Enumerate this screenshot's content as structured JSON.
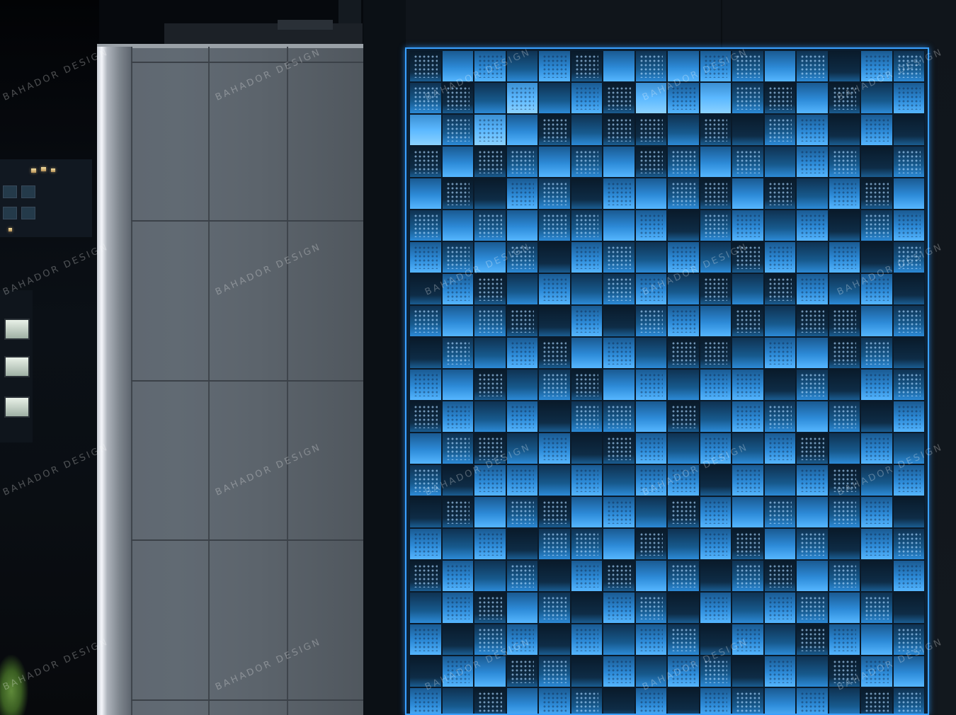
{
  "photo": {
    "watermark_text": "BAHADOR DESIGN",
    "colors": {
      "facade_glow": "#3aa0ff",
      "grey_panel": "#5e666f",
      "night_sky": "#06090d"
    },
    "facade_pattern": [
      [
        0,
        2,
        2,
        1,
        2,
        0,
        2,
        1,
        2,
        2,
        1,
        2,
        1,
        0,
        2,
        1
      ],
      [
        1,
        0,
        1,
        3,
        1,
        2,
        0,
        3,
        2,
        3,
        1,
        0,
        2,
        0,
        1,
        2
      ],
      [
        3,
        1,
        3,
        2,
        0,
        1,
        0,
        0,
        1,
        0,
        0,
        1,
        2,
        0,
        2,
        0
      ],
      [
        0,
        2,
        0,
        1,
        2,
        1,
        2,
        0,
        1,
        2,
        1,
        1,
        2,
        1,
        0,
        1
      ],
      [
        2,
        0,
        0,
        2,
        1,
        0,
        2,
        2,
        1,
        0,
        2,
        0,
        1,
        2,
        0,
        2
      ],
      [
        1,
        2,
        1,
        2,
        1,
        1,
        2,
        2,
        0,
        1,
        2,
        1,
        2,
        0,
        1,
        2
      ],
      [
        2,
        1,
        2,
        1,
        0,
        2,
        1,
        1,
        2,
        1,
        0,
        2,
        1,
        2,
        0,
        1
      ],
      [
        0,
        2,
        0,
        1,
        2,
        1,
        1,
        2,
        1,
        0,
        1,
        0,
        2,
        1,
        2,
        0
      ],
      [
        1,
        2,
        1,
        0,
        0,
        2,
        0,
        1,
        2,
        2,
        0,
        1,
        0,
        0,
        2,
        1
      ],
      [
        0,
        1,
        1,
        2,
        0,
        2,
        2,
        1,
        0,
        0,
        1,
        2,
        2,
        0,
        1,
        0
      ],
      [
        2,
        2,
        0,
        1,
        1,
        0,
        2,
        2,
        1,
        2,
        2,
        0,
        1,
        0,
        2,
        1
      ],
      [
        0,
        2,
        1,
        2,
        0,
        1,
        1,
        2,
        0,
        1,
        2,
        1,
        2,
        1,
        0,
        2
      ],
      [
        2,
        1,
        0,
        1,
        2,
        0,
        0,
        2,
        1,
        2,
        1,
        2,
        0,
        1,
        2,
        1
      ],
      [
        1,
        0,
        2,
        2,
        1,
        2,
        1,
        2,
        2,
        0,
        2,
        1,
        2,
        0,
        1,
        2
      ],
      [
        0,
        0,
        2,
        1,
        0,
        2,
        2,
        1,
        0,
        2,
        2,
        1,
        2,
        1,
        2,
        0
      ],
      [
        2,
        1,
        2,
        0,
        1,
        1,
        2,
        0,
        1,
        2,
        0,
        2,
        1,
        0,
        2,
        1
      ],
      [
        0,
        2,
        1,
        1,
        0,
        2,
        0,
        2,
        1,
        0,
        1,
        0,
        2,
        1,
        0,
        2
      ],
      [
        1,
        2,
        0,
        2,
        1,
        0,
        2,
        1,
        0,
        2,
        1,
        2,
        1,
        2,
        1,
        0
      ],
      [
        2,
        0,
        1,
        2,
        0,
        2,
        1,
        2,
        1,
        0,
        2,
        1,
        0,
        2,
        2,
        1
      ],
      [
        0,
        2,
        2,
        0,
        1,
        0,
        2,
        1,
        2,
        1,
        0,
        2,
        1,
        0,
        2,
        2
      ],
      [
        2,
        1,
        0,
        2,
        2,
        1,
        0,
        2,
        0,
        2,
        1,
        2,
        2,
        1,
        0,
        1
      ]
    ]
  }
}
